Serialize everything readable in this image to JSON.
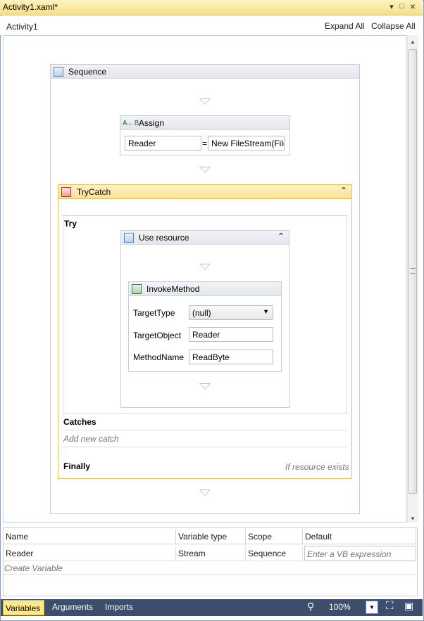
{
  "window": {
    "doc_tab": "Activity1.xaml*",
    "pin_glyph": "▾",
    "restore_glyph": "□",
    "close_glyph": "×"
  },
  "header": {
    "breadcrumb": "Activity1",
    "expand_all": "Expand All",
    "collapse_all": "Collapse All"
  },
  "sequence": {
    "title": "Sequence"
  },
  "assign": {
    "title": "Assign",
    "to": "Reader",
    "eq": "=",
    "value": "New FileStream(File"
  },
  "trycatch": {
    "title": "TryCatch",
    "try_label": "Try",
    "catches_label": "Catches",
    "add_catch": "Add new catch",
    "finally_label": "Finally",
    "finally_hint": "If resource exists"
  },
  "use_resource": {
    "title": "Use resource"
  },
  "invoke": {
    "title": "InvokeMethod",
    "target_type_label": "TargetType",
    "target_type_value": "(null)",
    "target_object_label": "TargetObject",
    "target_object_value": "Reader",
    "method_name_label": "MethodName",
    "method_name_value": "ReadByte"
  },
  "variables": {
    "columns": [
      "Name",
      "Variable type",
      "Scope",
      "Default"
    ],
    "rows": [
      {
        "name": "Reader",
        "type": "Stream",
        "scope": "Sequence",
        "default_placeholder": "Enter a VB expression"
      }
    ],
    "create": "Create Variable"
  },
  "bottom": {
    "tabs": [
      "Variables",
      "Arguments",
      "Imports"
    ],
    "zoom": "100%"
  },
  "colors": {
    "accent_yellow": "#fde88a",
    "bottom_bar": "#3c4d6e",
    "trycatch_border": "#e6c25e"
  }
}
